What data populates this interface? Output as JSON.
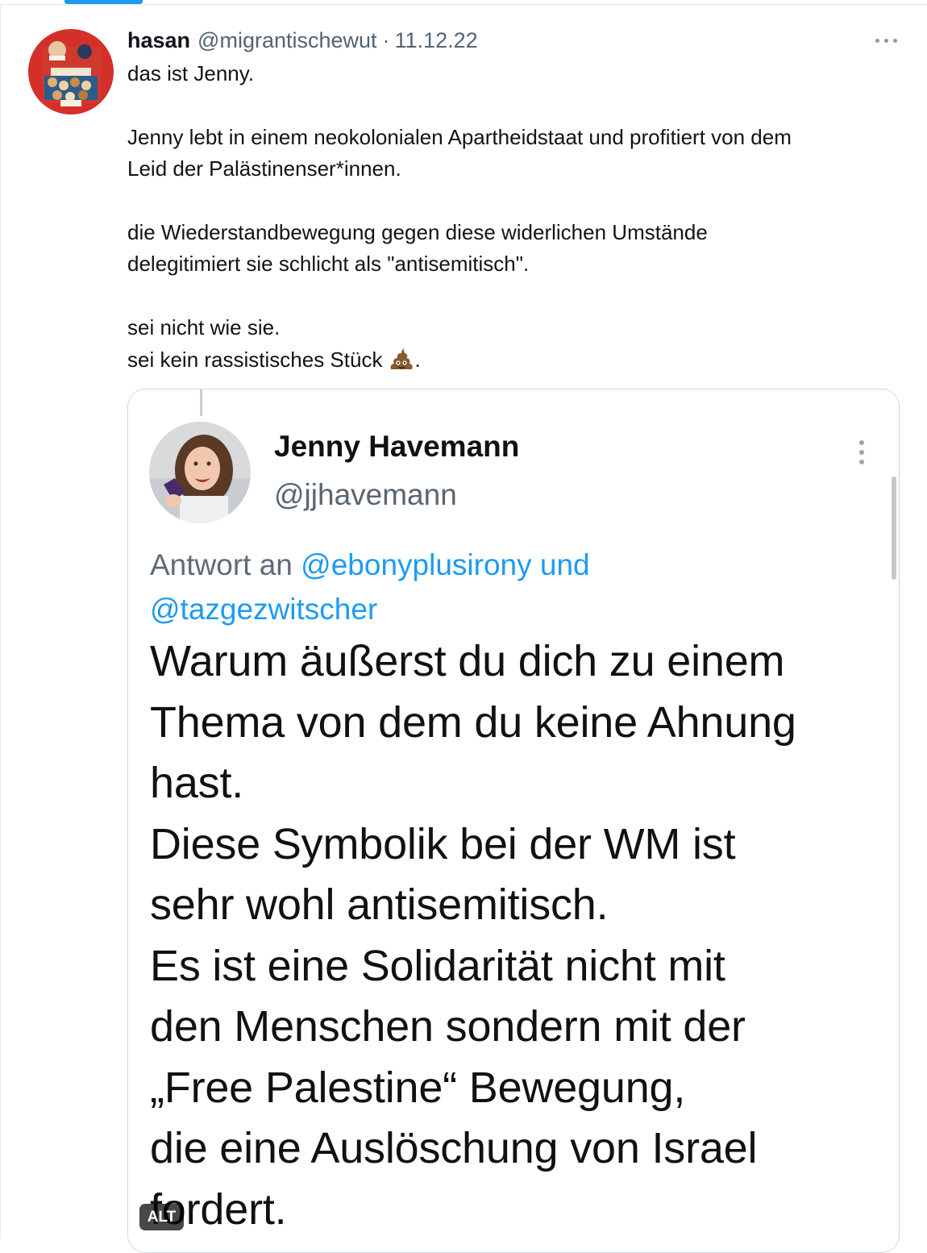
{
  "tweet": {
    "author_name": "hasan",
    "author_handle": "@migrantischewut",
    "separator": "·",
    "date": "11.12.22",
    "text_lines": [
      "das ist Jenny.",
      "",
      "Jenny lebt in einem neokolonialen Apartheidstaat und profitiert von dem",
      "Leid der Palästinenser*innen.",
      "",
      "die Wiederstandbewegung gegen diese widerlichen Umstände",
      "delegitimiert sie schlicht als \"antisemitisch\".",
      "",
      "sei nicht wie sie.",
      "sei kein rassistisches Stück"
    ],
    "last_line_suffix": ".",
    "emoji_icon": "pile-of-poo-icon",
    "more_icon": "more-horizontal-icon"
  },
  "embedded_screenshot": {
    "author_name": "Jenny Havemann",
    "author_handle": "@jjhavemann",
    "reply_prefix": "Antwort an",
    "reply_mention_1": "@ebonyplusirony und",
    "reply_mention_2": "@tazgezwitscher",
    "text_lines": [
      "Warum äußerst du dich zu einem",
      "Thema von dem du keine Ahnung",
      "hast.",
      "Diese Symbolik bei der WM ist",
      "sehr wohl antisemitisch.",
      "Es ist eine Solidarität nicht mit",
      "den Menschen sondern mit der",
      "„Free Palestine“ Bewegung,",
      "die eine Auslöschung von Israel",
      "fordert."
    ],
    "more_icon": "more-vertical-icon",
    "alt_badge": "ALT"
  },
  "colors": {
    "accent": "#1d9bf0",
    "text": "#0f1419",
    "secondary": "#536471",
    "border": "#cfd9de"
  }
}
